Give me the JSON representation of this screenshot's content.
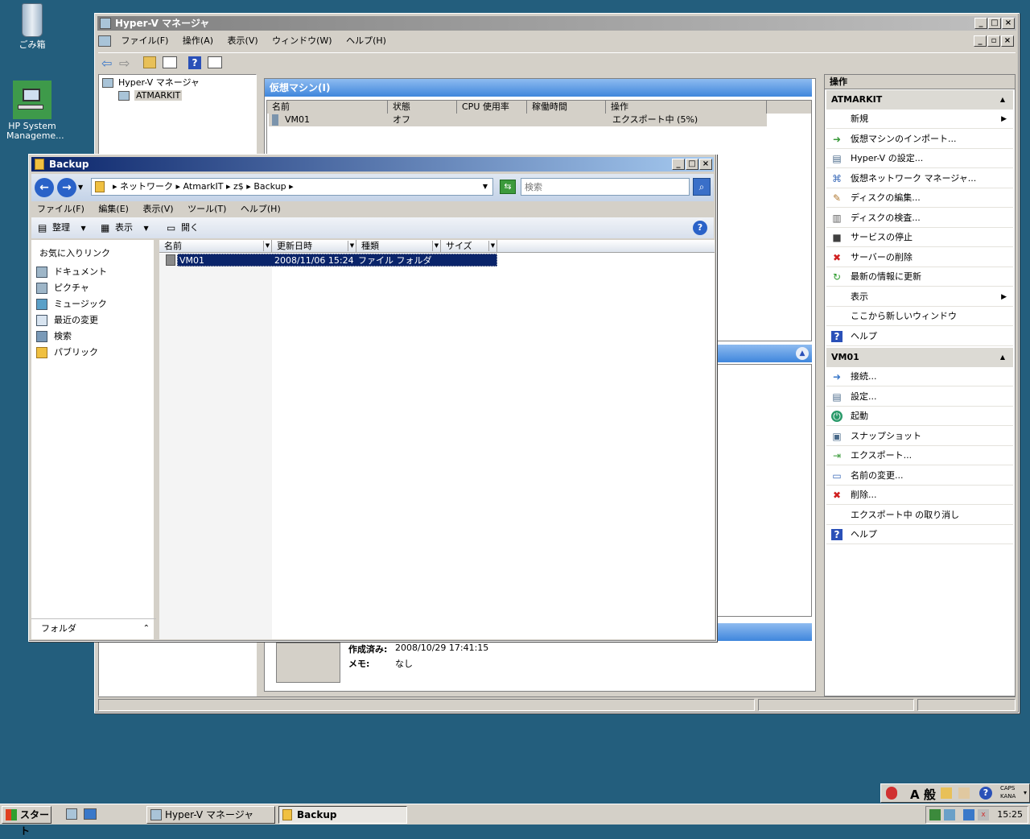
{
  "desktop": {
    "recycle_label": "ごみ箱",
    "hp_label": "HP System Manageme..."
  },
  "hv": {
    "title": "Hyper-V マネージャ",
    "menus": [
      "ファイル(F)",
      "操作(A)",
      "表示(V)",
      "ウィンドウ(W)",
      "ヘルプ(H)"
    ],
    "tree_root": "Hyper-V マネージャ",
    "tree_child": "ATMARKIT",
    "vm_header": "仮想マシン(I)",
    "columns": [
      "名前",
      "状態",
      "CPU 使用率",
      "稼働時間",
      "操作"
    ],
    "vm_row": {
      "name": "VM01",
      "state": "オフ",
      "cpu": "",
      "uptime": "",
      "operation": "エクスポート中 (5%)"
    },
    "details": {
      "created_label": "作成済み:",
      "created_value": "2008/10/29 17:41:15",
      "memo_label": "メモ:",
      "memo_value": "なし"
    }
  },
  "actions": {
    "title": "操作",
    "section1": "ATMARKIT",
    "items1": [
      {
        "label": "新規",
        "icon": "blank",
        "submenu": true
      },
      {
        "label": "仮想マシンのインポート...",
        "icon": "import-icon"
      },
      {
        "label": "Hyper-V の設定...",
        "icon": "settings-icon"
      },
      {
        "label": "仮想ネットワーク マネージャ...",
        "icon": "network-icon"
      },
      {
        "label": "ディスクの編集...",
        "icon": "edit-disk-icon"
      },
      {
        "label": "ディスクの検査...",
        "icon": "inspect-disk-icon"
      },
      {
        "label": "サービスの停止",
        "icon": "stop-icon"
      },
      {
        "label": "サーバーの削除",
        "icon": "delete-x-icon"
      },
      {
        "label": "最新の情報に更新",
        "icon": "refresh-icon"
      },
      {
        "label": "表示",
        "icon": "blank",
        "submenu": true
      },
      {
        "label": "ここから新しいウィンドウ",
        "icon": "blank"
      },
      {
        "label": "ヘルプ",
        "icon": "help-icon"
      }
    ],
    "section2": "VM01",
    "items2": [
      {
        "label": "接続...",
        "icon": "connect-icon"
      },
      {
        "label": "設定...",
        "icon": "settings-icon"
      },
      {
        "label": "起動",
        "icon": "power-icon"
      },
      {
        "label": "スナップショット",
        "icon": "snapshot-icon"
      },
      {
        "label": "エクスポート...",
        "icon": "export-icon"
      },
      {
        "label": "名前の変更...",
        "icon": "rename-icon"
      },
      {
        "label": "削除...",
        "icon": "delete-icon"
      },
      {
        "label": "エクスポート中 の取り消し",
        "icon": "blank"
      },
      {
        "label": "ヘルプ",
        "icon": "help-icon"
      }
    ]
  },
  "explorer": {
    "title": "Backup",
    "breadcrumb": [
      "ネットワーク",
      "AtmarkIT",
      "z$",
      "Backup"
    ],
    "search_placeholder": "検索",
    "menus": [
      "ファイル(F)",
      "編集(E)",
      "表示(V)",
      "ツール(T)",
      "ヘルプ(H)"
    ],
    "toolbar": {
      "organize": "整理",
      "view": "表示",
      "open": "開く"
    },
    "favorites_title": "お気に入りリンク",
    "favorites": [
      "ドキュメント",
      "ピクチャ",
      "ミュージック",
      "最近の変更",
      "検索",
      "パブリック"
    ],
    "folders_label": "フォルダ",
    "columns": [
      "名前",
      "更新日時",
      "種類",
      "サイズ"
    ],
    "file": {
      "name": "VM01",
      "modified": "2008/11/06 15:24",
      "type": "ファイル フォルダ",
      "size": ""
    }
  },
  "taskbar": {
    "start": "スタート",
    "tasks": [
      "Hyper-V マネージャ",
      "Backup"
    ],
    "clock": "15:25",
    "ime": "A 般",
    "caps": "CAPS",
    "kana": "KANA"
  }
}
